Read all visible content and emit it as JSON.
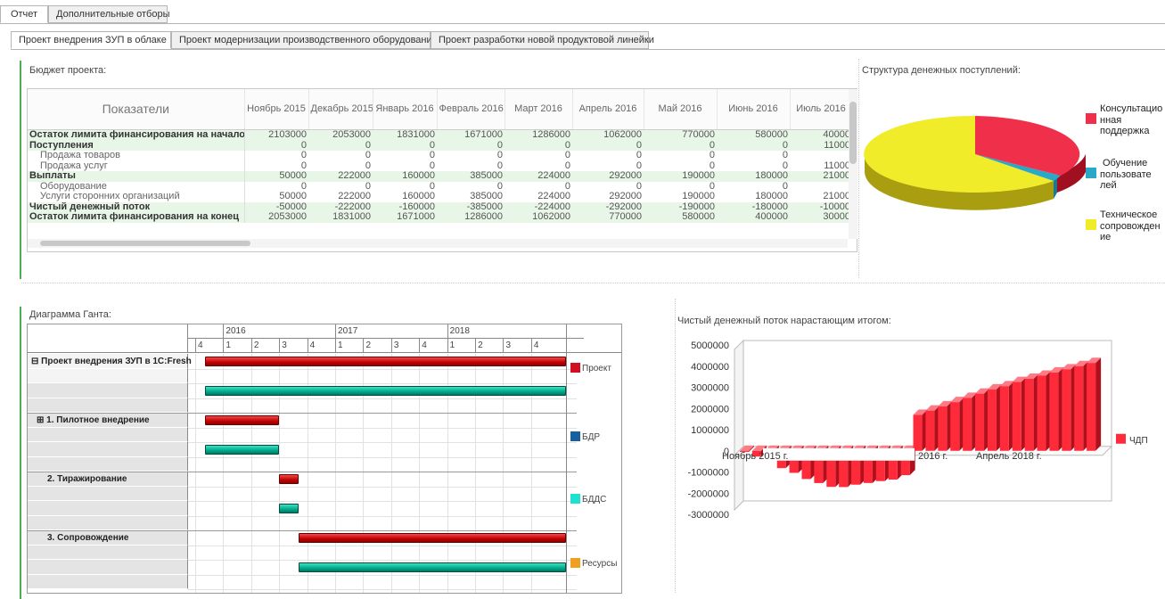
{
  "top_tabs": [
    {
      "label": "Отчет",
      "active": true
    },
    {
      "label": "Дополнительные отборы",
      "active": false
    }
  ],
  "project_tabs": [
    {
      "label": "Проект внедрения ЗУП в облаке",
      "active": true
    },
    {
      "label": "Проект модернизации производственного оборудования",
      "active": false
    },
    {
      "label": "Проект разработки новой продуктовой линейки",
      "active": false
    }
  ],
  "budget": {
    "title": "Бюджет проекта:",
    "header_label": "Показатели",
    "columns": [
      "Ноябрь 2015",
      "Декабрь 2015",
      "Январь 2016",
      "Февраль 2016",
      "Март 2016",
      "Апрель 2016",
      "Май 2016",
      "Июнь 2016",
      "Июль 2016"
    ],
    "rows": [
      {
        "label": "Остаток лимита финансирования на начало",
        "values": [
          "2103000",
          "2053000",
          "1831000",
          "1671000",
          "1286000",
          "1062000",
          "770000",
          "580000",
          "40000"
        ]
      },
      {
        "label": "Поступления",
        "values": [
          "0",
          "0",
          "0",
          "0",
          "0",
          "0",
          "0",
          "0",
          "11000"
        ]
      },
      {
        "label": "Продажа товаров",
        "values": [
          "0",
          "0",
          "0",
          "0",
          "0",
          "0",
          "0",
          "0",
          ""
        ]
      },
      {
        "label": "Продажа услуг",
        "values": [
          "0",
          "0",
          "0",
          "0",
          "0",
          "0",
          "0",
          "0",
          "11000"
        ]
      },
      {
        "label": "Выплаты",
        "values": [
          "50000",
          "222000",
          "160000",
          "385000",
          "224000",
          "292000",
          "190000",
          "180000",
          "21000"
        ]
      },
      {
        "label": "Оборудование",
        "values": [
          "0",
          "0",
          "0",
          "0",
          "0",
          "0",
          "0",
          "0",
          ""
        ]
      },
      {
        "label": "Услуги сторонних организаций",
        "values": [
          "50000",
          "222000",
          "160000",
          "385000",
          "224000",
          "292000",
          "190000",
          "180000",
          "21000"
        ]
      },
      {
        "label": "Чистый денежный поток",
        "values": [
          "-50000",
          "-222000",
          "-160000",
          "-385000",
          "-224000",
          "-292000",
          "-190000",
          "-180000",
          "-10000"
        ]
      },
      {
        "label": "Остаток лимита финансирования на конец",
        "values": [
          "2053000",
          "1831000",
          "1671000",
          "1286000",
          "1062000",
          "770000",
          "580000",
          "400000",
          "30000"
        ]
      }
    ]
  },
  "pie": {
    "title": "Структура денежных поступлений:",
    "legend": [
      {
        "label": "Консультационная поддержка",
        "lines": [
          "Консультацио",
          "нная",
          "поддержка"
        ],
        "color": "#f0304a"
      },
      {
        "label": "Обучение пользователей",
        "lines": [
          "Обучение",
          "пользовате",
          "лей"
        ],
        "color": "#2aa8c8"
      },
      {
        "label": "Техническое сопровождение",
        "lines": [
          "Техническое",
          "сопровожден",
          "ие"
        ],
        "color": "#f0ec2a"
      }
    ]
  },
  "gantt": {
    "title": "Диаграмма Ганта:",
    "years": [
      "2016",
      "2017",
      "2018"
    ],
    "quarters": [
      "4",
      "1",
      "2",
      "3",
      "4",
      "1",
      "2",
      "3",
      "4",
      "1",
      "2",
      "3",
      "4"
    ],
    "tasks": [
      {
        "label": "⊟ Проект внедрения ЗУП в 1С:Fresh"
      },
      {
        "label": "⊞ 1. Пилотное внедрение"
      },
      {
        "label": "2. Тиражирование"
      },
      {
        "label": "3. Сопровождение"
      }
    ],
    "legend": [
      {
        "label": "Проект",
        "color": "#d01020"
      },
      {
        "label": "БДР",
        "color": "#1a5f9e"
      },
      {
        "label": "БДДС",
        "color": "#20e0d0"
      },
      {
        "label": "Ресурсы",
        "color": "#f0a020"
      }
    ]
  },
  "cashflow": {
    "title": "Чистый денежный поток нарастающим итогом:",
    "chart_data": {
      "type": "bar",
      "ylim": [
        -3000000,
        5000000
      ],
      "yticks": [
        "5000000",
        "4000000",
        "3000000",
        "2000000",
        "1000000",
        "0",
        "-1000000",
        "-2000000",
        "-3000000"
      ],
      "xlabels": [
        "Ноябрь 2015 г.",
        "2016 г.",
        "Апрель 2018 г."
      ],
      "series": [
        {
          "name": "ЧДП",
          "values": [
            -50000,
            -272000,
            -432000,
            -817000,
            -1041000,
            -1333000,
            -1523000,
            -1703000,
            -1713000,
            -1600000,
            -1520000,
            -1430000,
            -1360000,
            -1150000,
            1700000,
            1900000,
            2100000,
            2300000,
            2500000,
            2700000,
            2900000,
            3050000,
            3250000,
            3400000,
            3550000,
            3700000,
            3850000,
            4000000,
            4150000
          ]
        }
      ]
    },
    "legend_color": "#ff2a3a"
  }
}
